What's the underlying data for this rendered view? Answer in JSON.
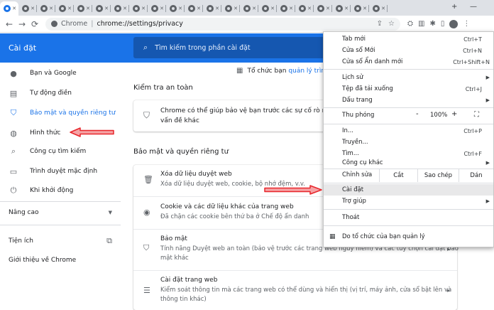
{
  "browser": {
    "omnibox": {
      "site": "Chrome",
      "url": "chrome://settings/privacy"
    }
  },
  "settings": {
    "title": "Cài đặt",
    "search_placeholder": "Tìm kiếm trong phần cài đặt",
    "managed_text": "Tổ chức bạn",
    "managed_link": "quản lý trình d",
    "sidebar": {
      "items": [
        {
          "label": "Bạn và Google",
          "icon": "person-icon"
        },
        {
          "label": "Tự động điền",
          "icon": "clipboard-icon"
        },
        {
          "label": "Bảo mật và quyền riêng tư",
          "icon": "shield-icon"
        },
        {
          "label": "Hình thức",
          "icon": "palette-icon"
        },
        {
          "label": "Công cụ tìm kiếm",
          "icon": "search-icon"
        },
        {
          "label": "Trình duyệt mặc định",
          "icon": "browser-icon"
        },
        {
          "label": "Khi khởi động",
          "icon": "power-icon"
        }
      ],
      "advanced": "Nâng cao",
      "extensions": "Tiện ích",
      "about": "Giới thiệu về Chrome"
    },
    "safety_check": {
      "title": "Kiểm tra an toàn",
      "text_line1": "Chrome có thể giúp bảo vệ bạn trước các sự cố rò rỉ dữ liệu",
      "text_line2": "vấn đề khác"
    },
    "privacy": {
      "title": "Bảo mật và quyền riêng tư",
      "rows": [
        {
          "title": "Xóa dữ liệu duyệt web",
          "sub1": "Xóa dữ liệu duyệt web, cookie, bộ nhớ đệm, v.v.",
          "sub2": ""
        },
        {
          "title": "Cookie và các dữ liệu khác của trang web",
          "sub1": "Đã chặn các cookie bên thứ ba ở Chế độ ẩn danh",
          "sub2": ""
        },
        {
          "title": "Bảo mật",
          "sub1": "Tính năng Duyệt web an toàn (bảo vệ trước các trang web nguy hiểm) và các tùy chọn cài đặt bảo",
          "sub2": "mật khác"
        },
        {
          "title": "Cài đặt trang web",
          "sub1": "Kiểm soát thông tin mà các trang web có thể dùng và hiển thị (vị trí, máy ảnh, cửa sổ bật lên và",
          "sub2": "thông tin khác)"
        }
      ]
    }
  },
  "menu": {
    "new_tab": "Tab mới",
    "new_tab_sc": "Ctrl+T",
    "new_window": "Cửa sổ Mới",
    "new_window_sc": "Ctrl+N",
    "incognito": "Cửa sổ Ẩn danh mới",
    "incognito_sc": "Ctrl+Shift+N",
    "history": "Lịch sử",
    "downloads": "Tệp đã tải xuống",
    "downloads_sc": "Ctrl+J",
    "bookmarks": "Dấu trang",
    "zoom": "Thu phóng",
    "zoom_minus": "-",
    "zoom_value": "100%",
    "zoom_plus": "+",
    "print": "In...",
    "print_sc": "Ctrl+P",
    "cast": "Truyền...",
    "find": "Tìm...",
    "find_sc": "Ctrl+F",
    "more_tools": "Công cụ khác",
    "edit": "Chỉnh sửa",
    "cut": "Cắt",
    "copy": "Sao chép",
    "paste": "Dán",
    "settings": "Cài đặt",
    "help": "Trợ giúp",
    "exit": "Thoát",
    "managed": "Do tổ chức của bạn quản lý"
  },
  "colors": {
    "accent": "#1a73e8",
    "annotation": "#e8262c"
  }
}
